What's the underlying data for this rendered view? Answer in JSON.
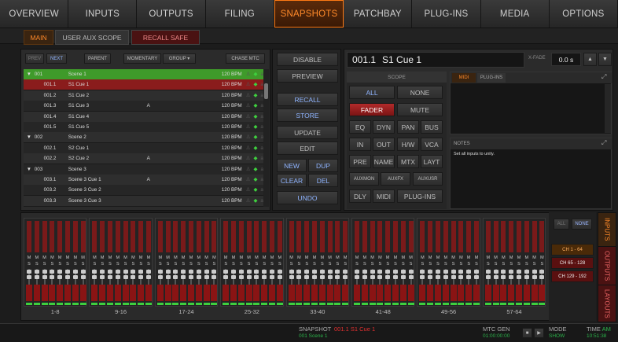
{
  "colors": {
    "accent": "#ff7a14",
    "selected": "#8a1c1c",
    "green_row": "#3f9a2a",
    "status_green": "#2bb34a"
  },
  "nav": {
    "tabs": [
      "OVERVIEW",
      "INPUTS",
      "OUTPUTS",
      "FILING",
      "SNAPSHOTS",
      "PATCHBAY",
      "PLUG-INS",
      "MEDIA",
      "OPTIONS"
    ],
    "active_index": 4
  },
  "subtabs": {
    "main": "MAIN",
    "user_aux_scope": "USER AUX SCOPE",
    "recall_safe": "RECALL SAFE"
  },
  "list_toolbar": {
    "prev": "PREV",
    "next": "NEXT",
    "parent": "PARENT",
    "momentary": "MOMENTARY",
    "group": "GROUP ▾",
    "chase_mtc": "CHASE MTC"
  },
  "snapshots": [
    {
      "num": "001",
      "name": "Scene 1",
      "bpm": "120 BPM",
      "mark": "",
      "toggle": "▼",
      "state": "group-active"
    },
    {
      "num": "001.1",
      "name": "S1 Cue 1",
      "bpm": "120 BPM",
      "mark": "",
      "toggle": "",
      "state": "selected"
    },
    {
      "num": "001.2",
      "name": "S1 Cue 2",
      "bpm": "120 BPM",
      "mark": "",
      "toggle": "",
      "state": ""
    },
    {
      "num": "001.3",
      "name": "S1 Cue 3",
      "bpm": "120 BPM",
      "mark": "A",
      "toggle": "",
      "state": ""
    },
    {
      "num": "001.4",
      "name": "S1 Cue 4",
      "bpm": "120 BPM",
      "mark": "",
      "toggle": "",
      "state": ""
    },
    {
      "num": "001.5",
      "name": "S1 Cue 5",
      "bpm": "120 BPM",
      "mark": "",
      "toggle": "",
      "state": ""
    },
    {
      "num": "002",
      "name": "Scene 2",
      "bpm": "120 BPM",
      "mark": "",
      "toggle": "▼",
      "state": ""
    },
    {
      "num": "002.1",
      "name": "S2 Cue 1",
      "bpm": "120 BPM",
      "mark": "",
      "toggle": "",
      "state": ""
    },
    {
      "num": "002.2",
      "name": "S2 Cue 2",
      "bpm": "120 BPM",
      "mark": "A",
      "toggle": "",
      "state": ""
    },
    {
      "num": "003",
      "name": "Scene 3",
      "bpm": "120 BPM",
      "mark": "",
      "toggle": "▼",
      "state": ""
    },
    {
      "num": "003.1",
      "name": "Scene 3 Cue 1",
      "bpm": "120 BPM",
      "mark": "A",
      "toggle": "",
      "state": ""
    },
    {
      "num": "003.2",
      "name": "Scene 3 Cue 2",
      "bpm": "120 BPM",
      "mark": "",
      "toggle": "",
      "state": ""
    },
    {
      "num": "003.3",
      "name": "Scene 3 Cue 3",
      "bpm": "120 BPM",
      "mark": "",
      "toggle": "",
      "state": ""
    }
  ],
  "actions": {
    "disable": "DISABLE",
    "preview": "PREVIEW",
    "recall": "RECALL",
    "store": "STORE",
    "update": "UPDATE",
    "edit": "EDIT",
    "new": "NEW",
    "dup": "DUP",
    "clear": "CLEAR",
    "del": "DEL",
    "undo": "UNDO"
  },
  "detail": {
    "number": "001.1",
    "name": "S1 Cue 1",
    "xfade_label": "X-FADE",
    "xfade_value": "0.0 s"
  },
  "scope": {
    "title": "SCOPE",
    "all": "ALL",
    "none": "NONE",
    "fader": "FADER",
    "mute": "MUTE",
    "eq": "EQ",
    "dyn": "DYN",
    "pan": "PAN",
    "bus": "BUS",
    "in": "IN",
    "out": "OUT",
    "hw": "H/W",
    "vca": "VCA",
    "pre": "PRE",
    "name": "NAME",
    "mtx": "MTX",
    "layt": "LAYT",
    "auxmon": "AUXMON",
    "auxfx": "AUXFX",
    "auxusr": "AUXUSR",
    "dly": "DLY",
    "midi": "MIDI",
    "plugins": "PLUG-INS"
  },
  "midi_tabs": {
    "midi": "MIDI",
    "plugins": "PLUG-INS"
  },
  "notes": {
    "title": "NOTES",
    "text": "Set all inputs to unity."
  },
  "fader_groups": [
    "1-8",
    "9-16",
    "17-24",
    "25-32",
    "33-40",
    "41-48",
    "49-56",
    "57-64"
  ],
  "strip_marks": {
    "m": "M",
    "s": "S"
  },
  "channel_select": {
    "all": "ALL",
    "none": "NONE",
    "ranges": [
      "CH 1 - 64",
      "CH 65 - 128",
      "CH 129 - 192"
    ]
  },
  "side_tabs": [
    "INPUTS",
    "OUTPUTS",
    "LAYOUTS"
  ],
  "status": {
    "snapshot_label": "SNAPSHOT",
    "current": "001.1 S1 Cue 1",
    "next": "001 Scene 1",
    "mtc_label": "MTC GEN",
    "mtc_value": "01:00:00:00",
    "mode_label": "MODE",
    "mode_value": "SHOW",
    "time_label": "TIME",
    "time_ampm": "AM",
    "time_value": "10:51:38"
  }
}
